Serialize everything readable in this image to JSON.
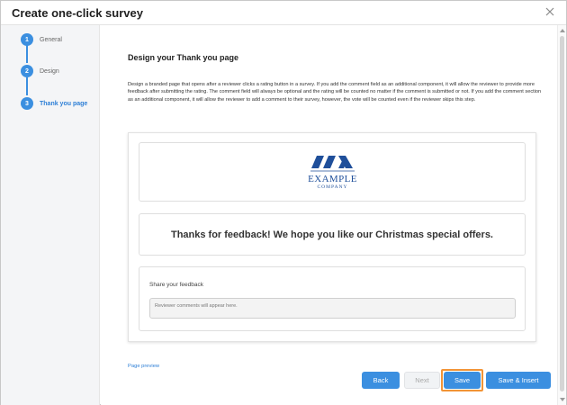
{
  "dialog": {
    "title": "Create one-click survey",
    "close_icon": "close-icon"
  },
  "steps": [
    {
      "number": "1",
      "label": "General",
      "state": "done"
    },
    {
      "number": "2",
      "label": "Design",
      "state": "done"
    },
    {
      "number": "3",
      "label": "Thank you page",
      "state": "active"
    }
  ],
  "main": {
    "title": "Design your Thank you page",
    "description": "Design a branded page that opens after a reviewer clicks a rating button in a survey. If you add the comment field as an additional component, it will allow the reviewer to provide more feedback after submitting the rating. The comment field will always be optional and the rating will be counted no matter if the comment is submitted or not. If you add the comment section as an additional component, it will allow the reviewer to add a comment to their survey, however, the vote will be counted even if the reviewer skips this step.",
    "preview": {
      "logo_text": "EXAMPLE",
      "logo_subtext": "COMPANY",
      "thanks_message": "Thanks for feedback! We hope you like our Christmas special offers.",
      "feedback_label": "Share your feedback",
      "feedback_placeholder": "Reviewer comments will appear here."
    },
    "preview_link": "Page preview"
  },
  "buttons": {
    "back": "Back",
    "next": "Next",
    "save": "Save",
    "save_insert": "Save & Insert"
  },
  "colors": {
    "accent": "#3b8fe0",
    "focus_outline": "#f29436",
    "logo_blue": "#1f4f9a"
  }
}
